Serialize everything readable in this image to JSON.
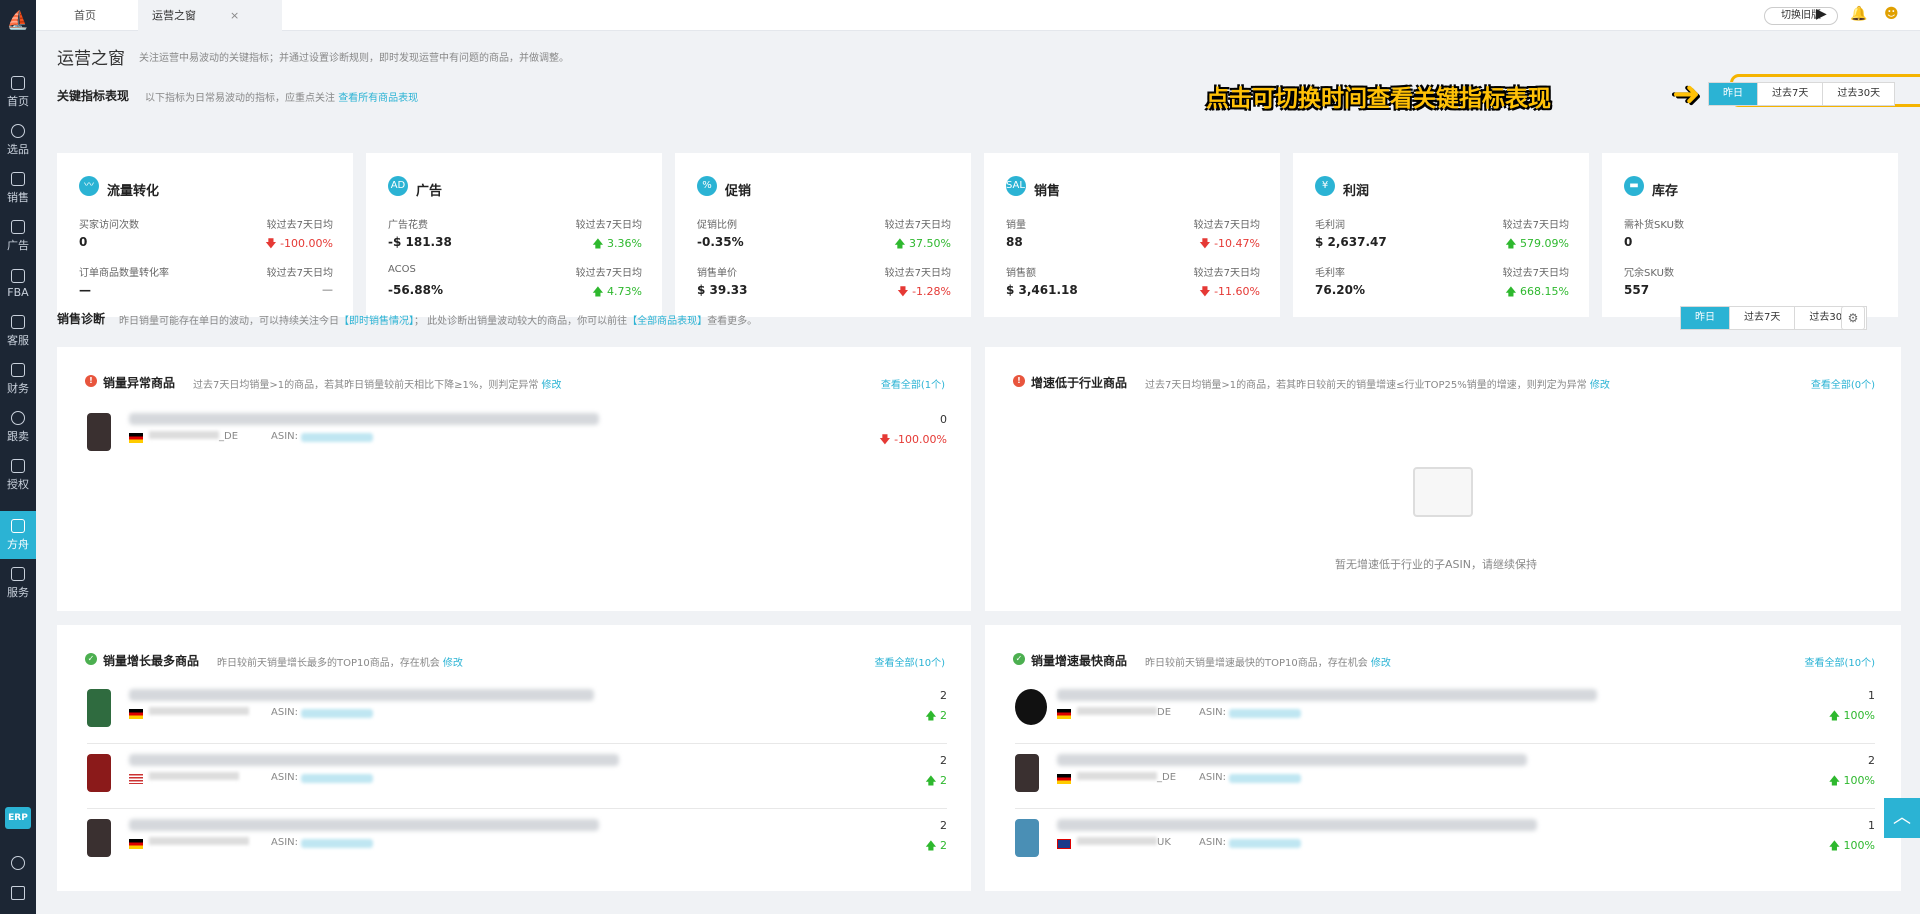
{
  "sidebar": {
    "items": [
      {
        "label": "首页",
        "icon": "home-icon"
      },
      {
        "label": "选品",
        "icon": "search-icon"
      },
      {
        "label": "销售",
        "icon": "chart-icon"
      },
      {
        "label": "广告",
        "icon": "ad-icon"
      },
      {
        "label": "FBA",
        "icon": "warehouse-icon"
      },
      {
        "label": "客服",
        "icon": "service-icon"
      },
      {
        "label": "财务",
        "icon": "finance-icon"
      },
      {
        "label": "跟卖",
        "icon": "pie-icon"
      },
      {
        "label": "授权",
        "icon": "shield-icon"
      },
      {
        "label": "方舟",
        "icon": "ark-icon"
      },
      {
        "label": "服务",
        "icon": "service-building-icon"
      }
    ],
    "erp": "ERP"
  },
  "tabs": [
    {
      "label": "首页"
    },
    {
      "label": "运营之窗",
      "close": "×"
    }
  ],
  "topbar": {
    "switch_old": "切换旧版"
  },
  "page": {
    "title": "运营之窗",
    "subtitle": "关注运营中易波动的关键指标；并通过设置诊断规则，即时发现运营中有问题的商品，并做调整。"
  },
  "kpi_section": {
    "title": "关键指标表现",
    "sub": "以下指标为日常易波动的指标，应重点关注",
    "link": "查看所有商品表现",
    "callout": "点击可切换时间查看关键指标表现",
    "range": [
      "昨日",
      "过去7天",
      "过去30天"
    ],
    "selected": 0
  },
  "cards": [
    {
      "icon_text": "〰",
      "title": "流量转化",
      "rows": [
        {
          "label": "买家访问次数",
          "cmp_label": "较过去7天日均",
          "value": "0",
          "change": "-100.00%",
          "dir": "down"
        },
        {
          "label": "订单商品数量转化率",
          "cmp_label": "较过去7天日均",
          "value": "—",
          "change": "—",
          "dir": "none"
        }
      ]
    },
    {
      "icon_text": "AD",
      "title": "广告",
      "rows": [
        {
          "label": "广告花费",
          "cmp_label": "较过去7天日均",
          "value": "-$ 181.38",
          "change": "3.36%",
          "dir": "up"
        },
        {
          "label": "ACOS",
          "cmp_label": "较过去7天日均",
          "value": "-56.88%",
          "change": "4.73%",
          "dir": "up"
        }
      ]
    },
    {
      "icon_text": "%",
      "title": "促销",
      "rows": [
        {
          "label": "促销比例",
          "cmp_label": "较过去7天日均",
          "value": "-0.35%",
          "change": "37.50%",
          "dir": "up"
        },
        {
          "label": "销售单价",
          "cmp_label": "较过去7天日均",
          "value": "$ 39.33",
          "change": "-1.28%",
          "dir": "down"
        }
      ]
    },
    {
      "icon_text": "SALE",
      "title": "销售",
      "rows": [
        {
          "label": "销量",
          "cmp_label": "较过去7天日均",
          "value": "88",
          "change": "-10.47%",
          "dir": "down"
        },
        {
          "label": "销售额",
          "cmp_label": "较过去7天日均",
          "value": "$ 3,461.18",
          "change": "-11.60%",
          "dir": "down"
        }
      ]
    },
    {
      "icon_text": "¥",
      "title": "利润",
      "rows": [
        {
          "label": "毛利润",
          "cmp_label": "较过去7天日均",
          "value": "$ 2,637.47",
          "change": "579.09%",
          "dir": "up"
        },
        {
          "label": "毛利率",
          "cmp_label": "较过去7天日均",
          "value": "76.20%",
          "change": "668.15%",
          "dir": "up"
        }
      ]
    },
    {
      "icon_text": "▬",
      "title": "库存",
      "rows": [
        {
          "label": "需补货SKU数",
          "cmp_label": "",
          "value": "0",
          "change": "",
          "dir": "none"
        },
        {
          "label": "冗余SKU数",
          "cmp_label": "",
          "value": "557",
          "change": "",
          "dir": "none"
        }
      ]
    }
  ],
  "diag_section": {
    "title": "销售诊断",
    "sub1": "昨日销量可能存在单日的波动，可以持续关注今日",
    "link1": "【即时销售情况】",
    "sub2": "；  此处诊断出销量波动较大的商品，你可以前往",
    "link2": "【全部商品表现】",
    "sub3": "查看更多。",
    "range": [
      "昨日",
      "过去7天",
      "过去30天"
    ],
    "gear": "⚙"
  },
  "panels": {
    "abnormal": {
      "title": "销量异常商品",
      "sub": "过去7天日均销量>1的商品，若其昨日销量较前天相比下降≥1%，则判定异常",
      "edit": "修改",
      "all": "查看全部(1个)",
      "rows": [
        {
          "sku": "_DE",
          "asin_label": "ASIN:",
          "qty": "0",
          "pct": "-100.00%",
          "dir": "down"
        }
      ]
    },
    "slow": {
      "title": "增速低于行业商品",
      "sub": "过去7天日均销量>1的商品，若其昨日较前天的销量增速≤行业TOP25%销量的增速，则判定为异常",
      "edit": "修改",
      "all": "查看全部(0个)",
      "empty": "暂无增速低于行业的子ASIN，请继续保持"
    },
    "most": {
      "title": "销量增长最多商品",
      "sub": "昨日较前天销量增长最多的TOP10商品，存在机会",
      "edit": "修改",
      "all": "查看全部(10个)",
      "rows": [
        {
          "sku": "",
          "asin_label": "ASIN:",
          "qty": "2",
          "pct": "2",
          "dir": "up"
        },
        {
          "sku": "",
          "asin_label": "ASIN:",
          "qty": "2",
          "pct": "2",
          "dir": "up"
        },
        {
          "sku": "",
          "asin_label": "ASIN:",
          "qty": "2",
          "pct": "2",
          "dir": "up"
        }
      ]
    },
    "fastest": {
      "title": "销量增速最快商品",
      "sub": "昨日较前天销量增速最快的TOP10商品，存在机会",
      "edit": "修改",
      "all": "查看全部(10个)",
      "rows": [
        {
          "sku": "DE",
          "asin_label": "ASIN:",
          "qty": "1",
          "pct": "100%",
          "dir": "up"
        },
        {
          "sku": "_DE",
          "asin_label": "ASIN:",
          "qty": "2",
          "pct": "100%",
          "dir": "up"
        },
        {
          "sku": "UK",
          "asin_label": "ASIN:",
          "qty": "1",
          "pct": "100%",
          "dir": "up"
        }
      ]
    }
  }
}
